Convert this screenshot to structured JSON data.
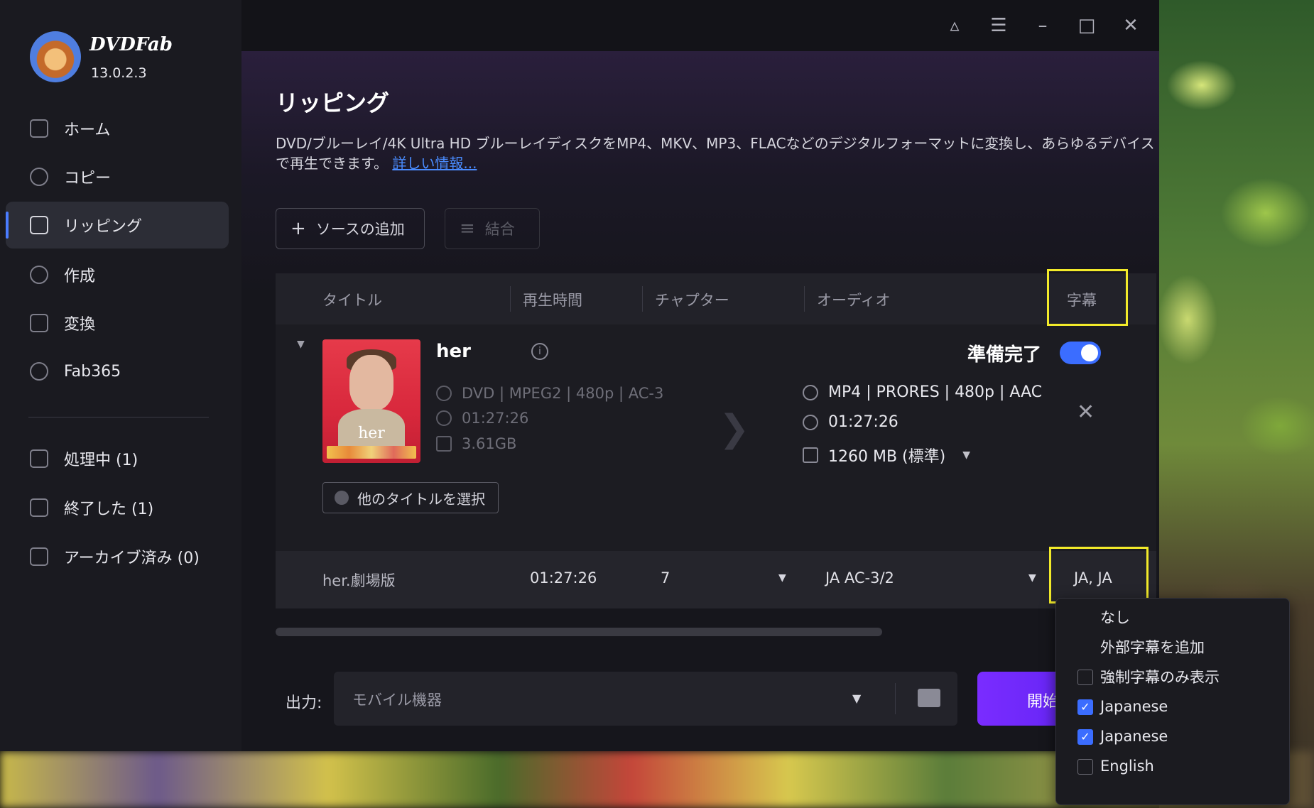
{
  "app": {
    "brand": "DVDFab",
    "version": "13.0.2.3"
  },
  "sidebar": {
    "items": [
      {
        "label": "ホーム"
      },
      {
        "label": "コピー"
      },
      {
        "label": "リッピング"
      },
      {
        "label": "作成"
      },
      {
        "label": "変換"
      },
      {
        "label": "Fab365"
      }
    ],
    "status_items": [
      {
        "label": "処理中 (1)"
      },
      {
        "label": "終了した (1)"
      },
      {
        "label": "アーカイブ済み (0)"
      }
    ]
  },
  "page": {
    "title": "リッピング",
    "description": "DVD/ブルーレイ/4K Ultra HD ブルーレイディスクをMP4、MKV、MP3、FLACなどのデジタルフォーマットに変換し、あらゆるデバイスで再生できます。",
    "more_link": "詳しい情報..."
  },
  "toolbar": {
    "add_source": "ソースの追加",
    "merge": "結合"
  },
  "table": {
    "headers": [
      "タイトル",
      "再生時間",
      "チャプター",
      "オーディオ",
      "字幕"
    ],
    "movie": {
      "title": "her",
      "poster_text": "her",
      "source_format": "DVD | MPEG2 | 480p | AC-3",
      "source_duration": "01:27:26",
      "source_size": "3.61GB",
      "output_format": "MP4 | PRORES | 480p | AAC",
      "output_duration": "01:27:26",
      "output_size": "1260 MB (標準)",
      "ready_label": "準備完了",
      "ready_on": true,
      "select_other": "他のタイトルを選択"
    },
    "row": {
      "title": "her.劇場版",
      "duration": "01:27:26",
      "chapters": "7",
      "audio": "JA  AC-3/2",
      "subtitles": "JA, JA"
    }
  },
  "output": {
    "label": "出力:",
    "value": "モバイル機器",
    "start": "開始"
  },
  "subtitle_menu": {
    "items": [
      {
        "label": "なし",
        "checkbox": false
      },
      {
        "label": "外部字幕を追加",
        "checkbox": false
      },
      {
        "label": "強制字幕のみ表示",
        "checkbox": true,
        "checked": false
      },
      {
        "label": "Japanese",
        "checkbox": true,
        "checked": true
      },
      {
        "label": "Japanese",
        "checkbox": true,
        "checked": true
      },
      {
        "label": "English",
        "checkbox": true,
        "checked": false
      }
    ]
  },
  "colors": {
    "accent": "#3b6dff",
    "highlight": "#f2ea2a",
    "start_button": "#7a2cff"
  }
}
